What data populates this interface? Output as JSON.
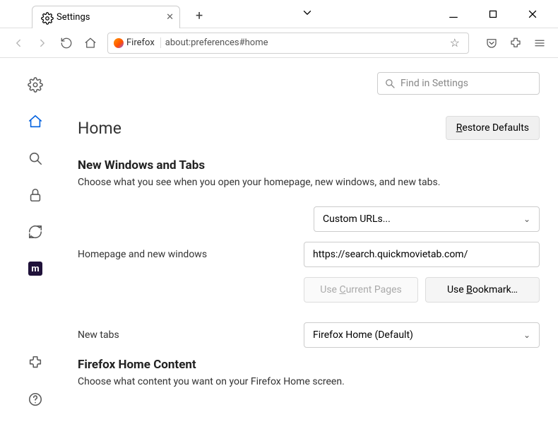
{
  "tab": {
    "title": "Settings"
  },
  "urlbar": {
    "badge": "Firefox",
    "address": "about:preferences#home"
  },
  "find_placeholder": "Find in Settings",
  "page_title": "Home",
  "restore_label": "Restore Defaults",
  "section1": {
    "heading": "New Windows and Tabs",
    "description": "Choose what you see when you open your homepage, new windows, and new tabs.",
    "homepage_dropdown": "Custom URLs...",
    "homepage_label": "Homepage and new windows",
    "homepage_url": "https://search.quickmovietab.com/",
    "use_current": "Use Current Pages",
    "use_bookmark": "Use Bookmark…",
    "newtabs_label": "New tabs",
    "newtabs_dropdown": "Firefox Home (Default)"
  },
  "section2": {
    "heading": "Firefox Home Content",
    "description": "Choose what content you want on your Firefox Home screen."
  }
}
